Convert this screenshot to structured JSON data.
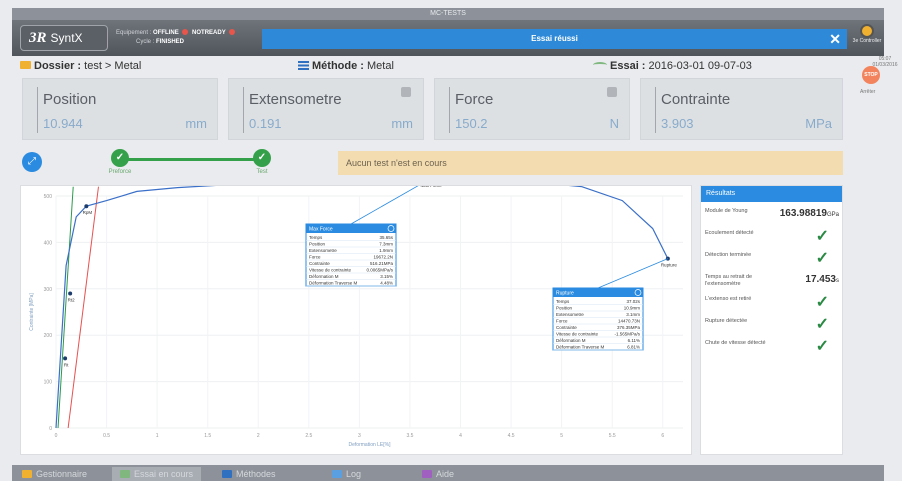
{
  "window": {
    "title": "MC-TESTS"
  },
  "header": {
    "logo_mark": "3R",
    "logo_text": "SyntX",
    "equipment_label": "Equipement :",
    "equipment_state": "OFFLINE",
    "equipment_ready": "NOTREADY",
    "cycle_label": "Cycle :",
    "cycle_state": "FINISHED",
    "status_message": "Essai réussi",
    "close_label": "✕",
    "user": "3e Controller"
  },
  "clock": {
    "time": "05:07",
    "date": "01/03/2016"
  },
  "breadcrumbs": {
    "folder_label": "Dossier : ",
    "folder_value": "test > Metal",
    "method_label": "Méthode : ",
    "method_value": "Metal",
    "test_label": "Essai : ",
    "test_value": "2016-03-01 09-07-03"
  },
  "stop": {
    "icon_label": "STOP",
    "label": "Arrêter"
  },
  "tiles": [
    {
      "label": "Position",
      "value": "10.944",
      "unit": "mm"
    },
    {
      "label": "Extensometre",
      "value": "0.191",
      "unit": "mm"
    },
    {
      "label": "Force",
      "value": "150.2",
      "unit": "N"
    },
    {
      "label": "Contrainte",
      "value": "3.903",
      "unit": "MPa"
    }
  ],
  "stepper": {
    "steps": [
      {
        "label": "Preforce",
        "check": "✓"
      },
      {
        "label": "Test",
        "check": "✓"
      }
    ],
    "message": "Aucun test n'est en cours"
  },
  "chart_data": {
    "type": "line",
    "xlabel": "Deformation LE[%]",
    "ylabel": "Contrainte [MPa]",
    "xlim": [
      0,
      6.2
    ],
    "ylim": [
      0,
      500
    ],
    "x_ticks": [
      "0",
      "0.5",
      "1",
      "1.5",
      "2",
      "2.5",
      "3",
      "3.5",
      "4",
      "4.5",
      "5",
      "5.5",
      "6"
    ],
    "y_ticks": [
      "0",
      "100",
      "200",
      "300",
      "400",
      "500"
    ],
    "series": [
      {
        "color": "#3a6fc8",
        "x": [
          0,
          0.1,
          0.2,
          0.3,
          0.5,
          0.8,
          1.2,
          2,
          3,
          3.7,
          4.5,
          5.2,
          5.6,
          5.9,
          6.05
        ],
        "y": [
          0,
          350,
          455,
          478,
          490,
          510,
          518,
          528,
          535,
          537,
          535,
          520,
          490,
          430,
          365
        ]
      }
    ],
    "offset_lines": [
      {
        "color": "#2a9a4a",
        "x": [
          0.02,
          0.17
        ],
        "y": [
          0,
          520
        ]
      },
      {
        "color": "#e85050",
        "x": [
          0.12,
          0.42
        ],
        "y": [
          0,
          520
        ]
      }
    ],
    "markers": [
      {
        "x": 0.09,
        "y": 150,
        "label": "Rt"
      },
      {
        "x": 0.14,
        "y": 290,
        "label": "Rt2"
      },
      {
        "x": 0.3,
        "y": 478,
        "label": "RpM"
      },
      {
        "x": 3.7,
        "y": 537,
        "label": "Max Force"
      },
      {
        "x": 6.05,
        "y": 365,
        "label": "Rupture"
      }
    ],
    "popups": [
      {
        "title": "Max Force",
        "rows": [
          [
            "Temps",
            "35.65s"
          ],
          [
            "Position",
            "7.3mm"
          ],
          [
            "Extensometre",
            "1.9mm"
          ],
          [
            "Force",
            "19672.2N"
          ],
          [
            "Contrainte",
            "516.21MPa"
          ],
          [
            "Vitesse de contrainte",
            "0.0065MPa/s"
          ],
          [
            "Déformation M",
            "3.15%"
          ],
          [
            "Déformation Traverse M",
            "4.48%"
          ]
        ]
      },
      {
        "title": "Rupture",
        "rows": [
          [
            "Temps",
            "37.02s"
          ],
          [
            "Position",
            "10.9mm"
          ],
          [
            "Extensometre",
            "3.1mm"
          ],
          [
            "Force",
            "14470.73N"
          ],
          [
            "Contrainte",
            "376.35MPa"
          ],
          [
            "Vitesse de contrainte",
            "-1.565MPa/s"
          ],
          [
            "Déformation M",
            "6.11%"
          ],
          [
            "Déformation Traverse M",
            "6.81%"
          ]
        ]
      }
    ]
  },
  "results": {
    "title": "Résultats",
    "items": [
      {
        "label": "Module de Young",
        "value": "163.98819",
        "unit": "GPa"
      },
      {
        "label": "Ecoulement détecté",
        "check": "✓"
      },
      {
        "label": "Détection terminée",
        "check": "✓"
      },
      {
        "label": "Temps au retrait de l'extensomètre",
        "value": "17.453",
        "unit": "s"
      },
      {
        "label": "L'extenso est retiré",
        "check": "✓"
      },
      {
        "label": "Rupture détectée",
        "check": "✓"
      },
      {
        "label": "Chute de vitesse détecté",
        "check": "✓"
      }
    ]
  },
  "tabs": [
    {
      "label": "Gestionnaire",
      "color": "#f0b030"
    },
    {
      "label": "Essai en cours",
      "color": "#7fb77f"
    },
    {
      "label": "Méthodes",
      "color": "#3070c0"
    },
    {
      "label": "Log",
      "color": "#5aa0e0"
    },
    {
      "label": "Aide",
      "color": "#a060c0"
    }
  ]
}
